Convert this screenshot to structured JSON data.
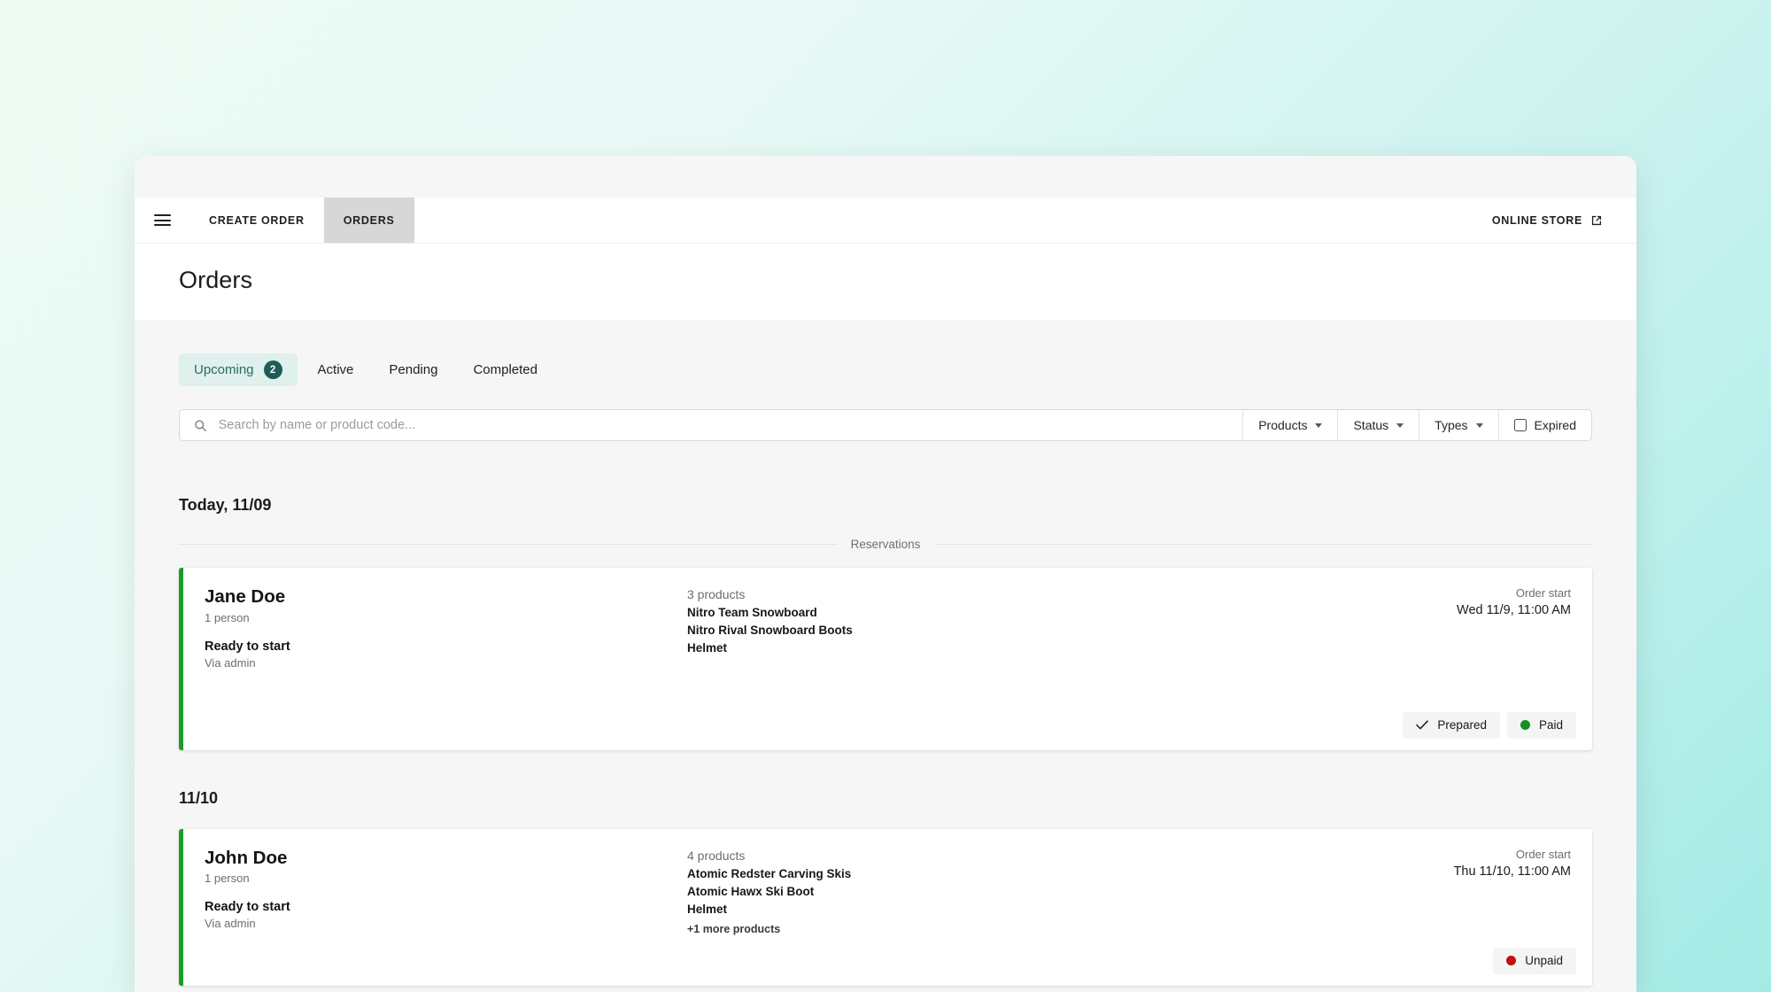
{
  "nav": {
    "menu_icon": "hamburger-icon",
    "items": [
      {
        "label": "CREATE ORDER",
        "active": false
      },
      {
        "label": "ORDERS",
        "active": true
      }
    ],
    "online_store": {
      "label": "ONLINE STORE",
      "icon": "external-link-icon"
    }
  },
  "header": {
    "title": "Orders"
  },
  "tabs": [
    {
      "label": "Upcoming",
      "badge": "2",
      "active": true
    },
    {
      "label": "Active",
      "badge": null,
      "active": false
    },
    {
      "label": "Pending",
      "badge": null,
      "active": false
    },
    {
      "label": "Completed",
      "badge": null,
      "active": false
    }
  ],
  "search": {
    "placeholder": "Search by name or product code...",
    "value": "",
    "icon": "search-icon"
  },
  "filters": {
    "products": "Products",
    "status": "Status",
    "types": "Types",
    "expired": "Expired",
    "expired_checked": false
  },
  "groups": [
    {
      "date_label": "Today, 11/09",
      "section_label": "Reservations",
      "orders": [
        {
          "customer": "Jane Doe",
          "people": "1 person",
          "state": "Ready to start",
          "source": "Via admin",
          "products_count": "3 products",
          "products": [
            "Nitro Team Snowboard",
            "Nitro Rival Snowboard Boots",
            "Helmet"
          ],
          "more_products": null,
          "start_label": "Order start",
          "start_value": "Wed 11/9, 11:00 AM",
          "actions": [
            {
              "label": "Prepared",
              "icon": "check-icon",
              "dot": null
            },
            {
              "label": "Paid",
              "icon": null,
              "dot": "paid"
            }
          ]
        }
      ]
    },
    {
      "date_label": "11/10",
      "section_label": null,
      "orders": [
        {
          "customer": "John Doe",
          "people": "1 person",
          "state": "Ready to start",
          "source": "Via admin",
          "products_count": "4 products",
          "products": [
            "Atomic Redster Carving Skis",
            "Atomic Hawx Ski Boot",
            "Helmet"
          ],
          "more_products": "+1 more products",
          "start_label": "Order start",
          "start_value": "Thu 11/10, 11:00 AM",
          "actions": [
            {
              "label": "Unpaid",
              "icon": null,
              "dot": "unpaid"
            }
          ]
        }
      ]
    }
  ],
  "colors": {
    "accent_border": "#1b9c2a",
    "tab_active_bg": "#dff0ed",
    "tab_active_text": "#2c6b64",
    "badge_bg": "#1d5c57",
    "paid_dot": "#159024",
    "unpaid_dot": "#c40d0d"
  }
}
